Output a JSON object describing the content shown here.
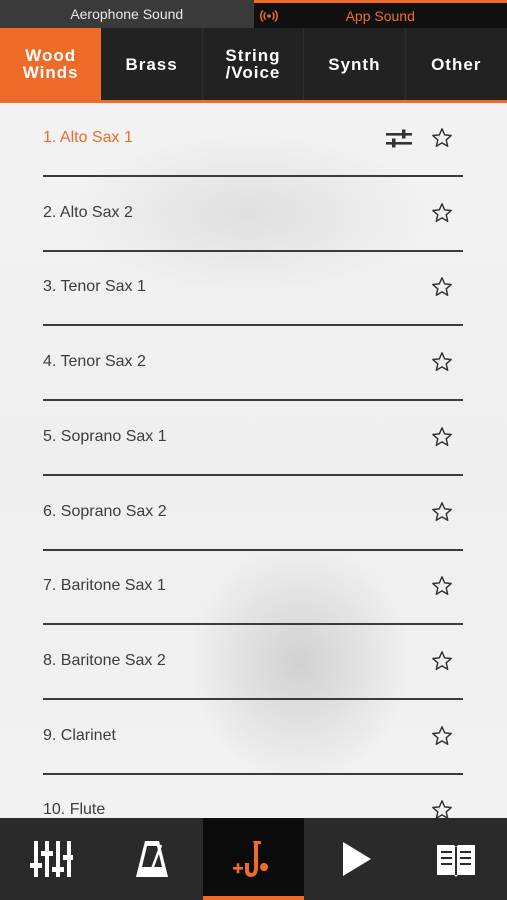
{
  "source_tabs": [
    {
      "label": "Aerophone Sound",
      "active": false
    },
    {
      "label": "App Sound",
      "active": true
    }
  ],
  "categories": [
    {
      "line1": "Wood",
      "line2": "Winds",
      "active": true
    },
    {
      "line1": "Brass",
      "line2": "",
      "active": false
    },
    {
      "line1": "String",
      "line2": "/Voice",
      "active": false
    },
    {
      "line1": "Synth",
      "line2": "",
      "active": false
    },
    {
      "line1": "Other",
      "line2": "",
      "active": false
    }
  ],
  "sounds": [
    {
      "label": "1. Alto Sax 1",
      "selected": true,
      "editable": true
    },
    {
      "label": "2. Alto Sax 2",
      "selected": false
    },
    {
      "label": "3. Tenor Sax 1",
      "selected": false
    },
    {
      "label": "4. Tenor Sax 2",
      "selected": false
    },
    {
      "label": "5. Soprano Sax 1",
      "selected": false
    },
    {
      "label": "6. Soprano Sax 2",
      "selected": false
    },
    {
      "label": "7. Baritone Sax 1",
      "selected": false
    },
    {
      "label": "8. Baritone Sax 2",
      "selected": false
    },
    {
      "label": "9. Clarinet",
      "selected": false
    },
    {
      "label": "10. Flute",
      "selected": false
    }
  ],
  "bottom_nav": [
    {
      "icon": "mixer-icon",
      "active": false
    },
    {
      "icon": "metronome-icon",
      "active": false
    },
    {
      "icon": "saxophone-add-icon",
      "active": true
    },
    {
      "icon": "play-icon",
      "active": false
    },
    {
      "icon": "book-icon",
      "active": false
    }
  ],
  "colors": {
    "accent": "#ef6b2a",
    "nav_bg": "#2a2a2a",
    "list_bg": "#f2f2f2"
  }
}
